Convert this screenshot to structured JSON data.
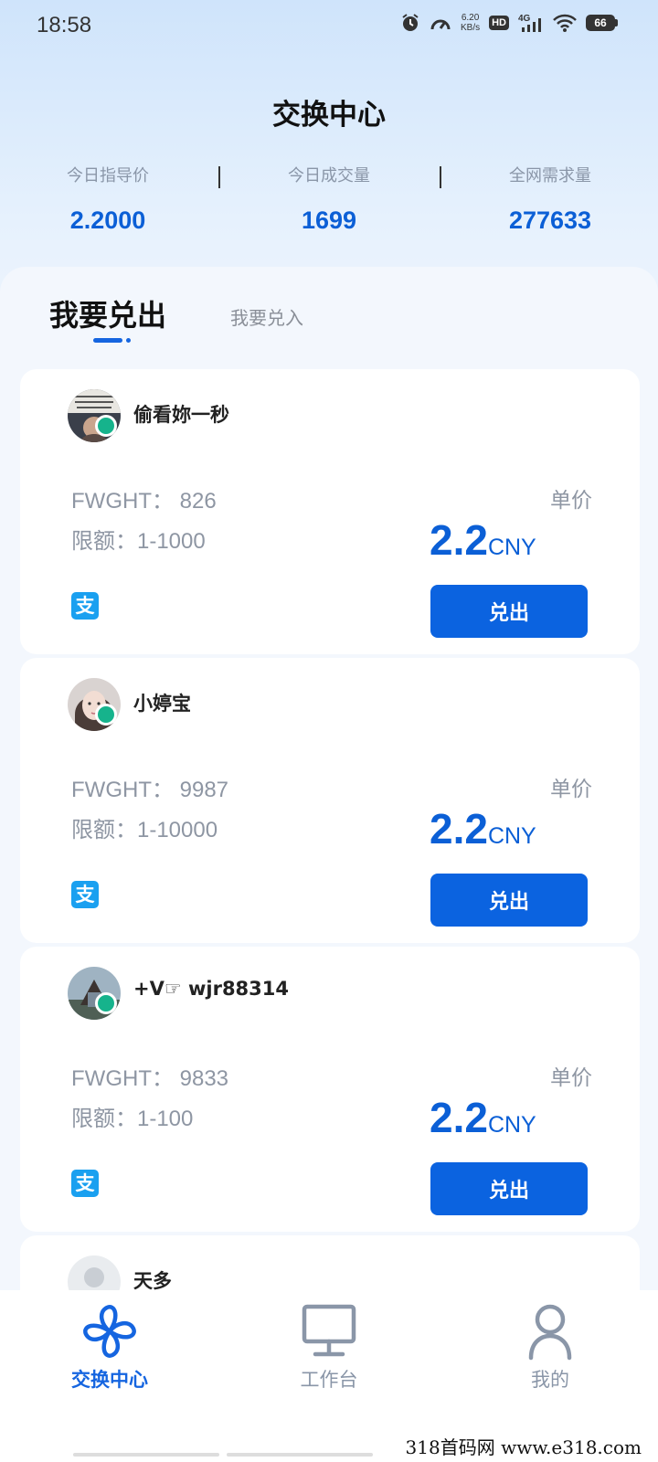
{
  "status_bar": {
    "time": "18:58",
    "net_speed_value": "6.20",
    "net_speed_unit": "KB/s",
    "hd_label": "HD",
    "network": "4G",
    "battery": "66"
  },
  "header": {
    "title": "交换中心"
  },
  "stats": [
    {
      "label": "今日指导价",
      "value": "2.2000"
    },
    {
      "label": "今日成交量",
      "value": "1699"
    },
    {
      "label": "全网需求量",
      "value": "277633"
    }
  ],
  "tabs": {
    "active": "我要兑出",
    "inactive": "我要兑入"
  },
  "listings": [
    {
      "username": "偷看妳一秒",
      "amount": "FWGHT：  826",
      "limit": "限额：1-1000",
      "unit_label": "单价",
      "price": "2.2",
      "currency": "CNY",
      "payment_icon": "支",
      "action": "兑出"
    },
    {
      "username": "小婷宝",
      "amount": "FWGHT：  9987",
      "limit": "限额：1-10000",
      "unit_label": "单价",
      "price": "2.2",
      "currency": "CNY",
      "payment_icon": "支",
      "action": "兑出"
    },
    {
      "username": "+V☞ wjr88314",
      "amount": "FWGHT：  9833",
      "limit": "限额：1-100",
      "unit_label": "单价",
      "price": "2.2",
      "currency": "CNY",
      "payment_icon": "支",
      "action": "兑出"
    },
    {
      "username": "天多"
    }
  ],
  "bottom_nav": [
    {
      "label": "交换中心",
      "icon": "pinwheel-icon",
      "active": true
    },
    {
      "label": "工作台",
      "icon": "monitor-icon",
      "active": false
    },
    {
      "label": "我的",
      "icon": "user-icon",
      "active": false
    }
  ],
  "watermark": "318首码网  www.e318.com",
  "colors": {
    "accent": "#0b63e0",
    "price_blue": "#0b5fd6",
    "online": "#16b38c",
    "alipay": "#1aa0f0"
  }
}
